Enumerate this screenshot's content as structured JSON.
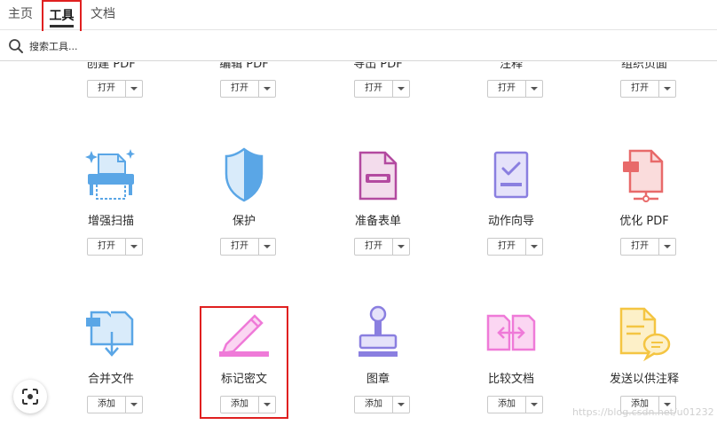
{
  "tabs": {
    "home": "主页",
    "tools": "工具",
    "docs": "文档"
  },
  "search": {
    "placeholder": "搜索工具..."
  },
  "colors": {
    "highlight": "#e02020",
    "blue_icon": "#5aa6e6",
    "purple_icon": "#b34aa0",
    "lilac_icon": "#8a7fe0",
    "red_icon": "#e86a6a",
    "pink_icon": "#ef7ad8",
    "yellow_icon": "#f4c542"
  },
  "tools": {
    "row0": [
      {
        "label": "创建 PDF",
        "button": "打开"
      },
      {
        "label": "编辑 PDF",
        "button": "打开"
      },
      {
        "label": "导出 PDF",
        "button": "打开"
      },
      {
        "label": "注释",
        "button": "打开"
      },
      {
        "label": "组织页面",
        "button": "打开"
      }
    ],
    "row1": [
      {
        "label": "增强扫描",
        "button": "打开",
        "icon": "scan-icon"
      },
      {
        "label": "保护",
        "button": "打开",
        "icon": "shield-icon"
      },
      {
        "label": "准备表单",
        "button": "打开",
        "icon": "form-icon"
      },
      {
        "label": "动作向导",
        "button": "打开",
        "icon": "action-wizard-icon"
      },
      {
        "label": "优化 PDF",
        "button": "打开",
        "icon": "optimize-pdf-icon"
      }
    ],
    "row2": [
      {
        "label": "合并文件",
        "button": "添加",
        "icon": "combine-files-icon"
      },
      {
        "label": "标记密文",
        "button": "添加",
        "icon": "redact-icon"
      },
      {
        "label": "图章",
        "button": "添加",
        "icon": "stamp-icon"
      },
      {
        "label": "比较文档",
        "button": "添加",
        "icon": "compare-icon"
      },
      {
        "label": "发送以供注释",
        "button": "添加",
        "icon": "send-comment-icon"
      }
    ]
  },
  "watermark": "https://blog.csdn.net/u01232"
}
